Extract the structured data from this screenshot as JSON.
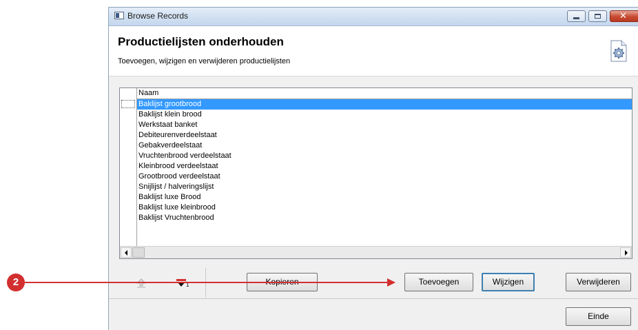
{
  "window": {
    "title": "Browse Records",
    "close_glyph": "✕"
  },
  "header": {
    "heading": "Productielijsten onderhouden",
    "subheading": "Toevoegen, wijzigen en verwijderen productielijsten",
    "icon": "settings-document-icon"
  },
  "grid": {
    "column_header": "Naam",
    "selected_index": 0,
    "rows": [
      "Baklijst grootbrood",
      "Baklijst klein brood",
      "Werkstaat banket",
      "Debiteurenverdeelstaat",
      "Gebakverdeelstaat",
      "Vruchtenbrood verdeelstaat",
      "Kleinbrood verdeelstaat",
      "Grootbrood verdeelstaat",
      "Snijlijst / halveringslijst",
      "Baklijst luxe Brood",
      "Baklijst luxe kleinbrood",
      "Baklijst Vruchtenbrood"
    ]
  },
  "toolbar": {
    "move_up_icon": "move-up-icon",
    "sort_icon": "sort-down-icon",
    "sort_badge": "1",
    "copy_label": "Kopieren",
    "add_label": "Toevoegen",
    "edit_label": "Wijzigen",
    "delete_label": "Verwijderen"
  },
  "footer": {
    "end_label": "Einde"
  },
  "annotation": {
    "step_number": "2",
    "color": "#d32f2f"
  },
  "colors": {
    "selection": "#3399ff",
    "titlebar": "#cfdff1",
    "close_button": "#c74a31"
  }
}
